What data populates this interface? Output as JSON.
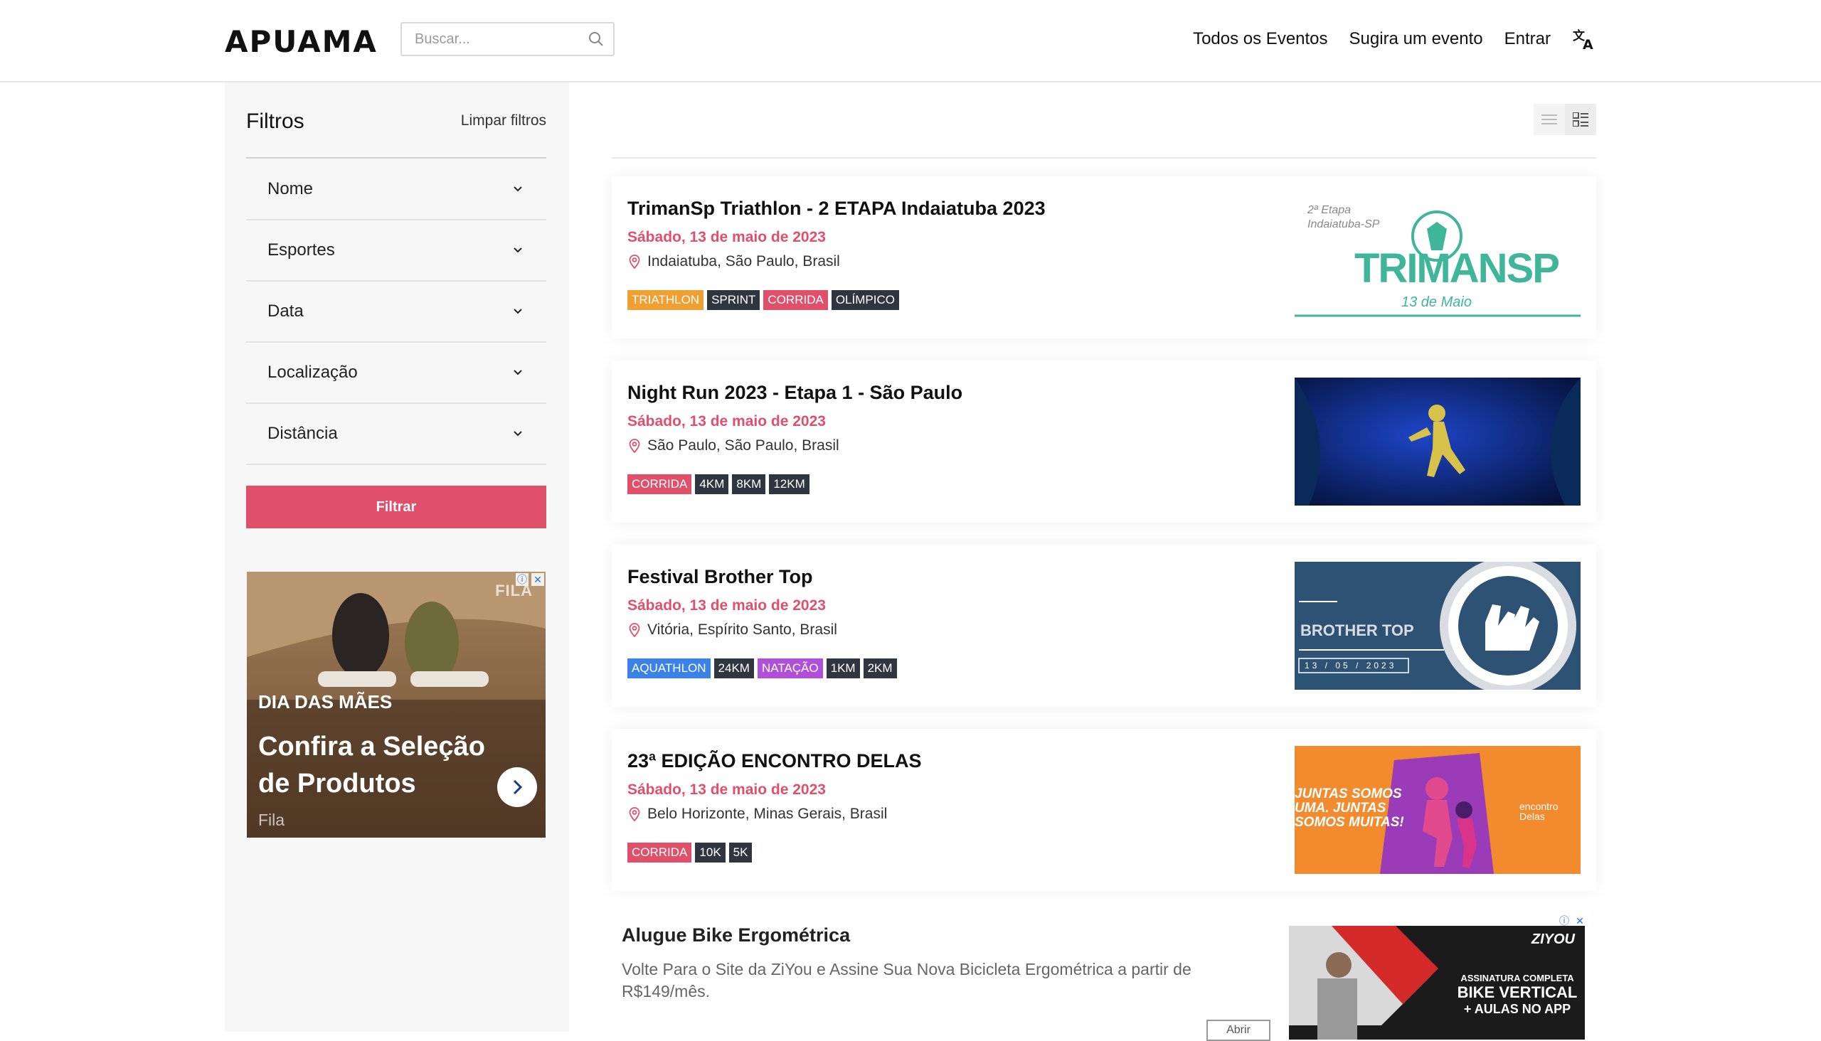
{
  "header": {
    "logo": "APUAMA",
    "search_placeholder": "Buscar...",
    "nav": [
      "Todos os Eventos",
      "Sugira um evento",
      "Entrar"
    ]
  },
  "sidebar": {
    "title": "Filtros",
    "clear_label": "Limpar filtros",
    "filters": [
      "Nome",
      "Esportes",
      "Data",
      "Localização",
      "Distância"
    ],
    "filter_button": "Filtrar",
    "ad": {
      "brand": "FILA",
      "kicker": "DIA DAS MÃES",
      "headline": "Confira a Seleção de Produtos",
      "sponsor": "Fila"
    }
  },
  "events": [
    {
      "title": "TrimanSp Triathlon - 2 ETAPA Indaiatuba 2023",
      "date": "Sábado, 13 de maio de 2023",
      "location": "Indaiatuba, São Paulo, Brasil",
      "tags": [
        {
          "label": "TRIATHLON",
          "color": "#f0a030"
        },
        {
          "label": "SPRINT",
          "color": "#2f3640"
        },
        {
          "label": "CORRIDA",
          "color": "#e0506b"
        },
        {
          "label": "OLÍMPICO",
          "color": "#2f3640"
        }
      ],
      "thumb": {
        "line1": "2ª Etapa",
        "line2": "Indaiatuba-SP",
        "word": "TRIMANSP",
        "date": "13 de Maio"
      }
    },
    {
      "title": "Night Run 2023 - Etapa 1 - São Paulo",
      "date": "Sábado, 13 de maio de 2023",
      "location": "São Paulo, São Paulo, Brasil",
      "tags": [
        {
          "label": "CORRIDA",
          "color": "#e0506b"
        },
        {
          "label": "4KM",
          "color": "#2f3640"
        },
        {
          "label": "8KM",
          "color": "#2f3640"
        },
        {
          "label": "12KM",
          "color": "#2f3640"
        }
      ]
    },
    {
      "title": "Festival Brother Top",
      "date": "Sábado, 13 de maio de 2023",
      "location": "Vitória, Espírito Santo, Brasil",
      "tags": [
        {
          "label": "AQUATHLON",
          "color": "#3b82e8"
        },
        {
          "label": "24KM",
          "color": "#2f3640"
        },
        {
          "label": "NATAÇÃO",
          "color": "#b04fd8"
        },
        {
          "label": "1KM",
          "color": "#2f3640"
        },
        {
          "label": "2KM",
          "color": "#2f3640"
        }
      ],
      "thumb": {
        "word": "BROTHER TOP",
        "date": "13 / 05 / 2023"
      }
    },
    {
      "title": "23ª EDIÇÃO ENCONTRO DELAS",
      "date": "Sábado, 13 de maio de 2023",
      "location": "Belo Horizonte, Minas Gerais, Brasil",
      "tags": [
        {
          "label": "CORRIDA",
          "color": "#e0506b"
        },
        {
          "label": "10K",
          "color": "#2f3640"
        },
        {
          "label": "5K",
          "color": "#2f3640"
        }
      ],
      "thumb": {
        "line1": "JUNTAS SOMOS",
        "line2": "UMA. JUNTAS",
        "line3": "SOMOS MUITAS!",
        "brand": "encontro Delas"
      }
    }
  ],
  "text_ad": {
    "title": "Alugue Bike Ergométrica",
    "description": "Volte Para o Site da ZiYou e Assine Sua Nova Bicicleta Ergométrica a partir de R$149/mês.",
    "brand": "ZIYOU",
    "img_line1": "ASSINATURA COMPLETA",
    "img_line2": "BIKE VERTICAL",
    "img_line3": "+ AULAS NO APP",
    "open_label": "Abrir"
  }
}
